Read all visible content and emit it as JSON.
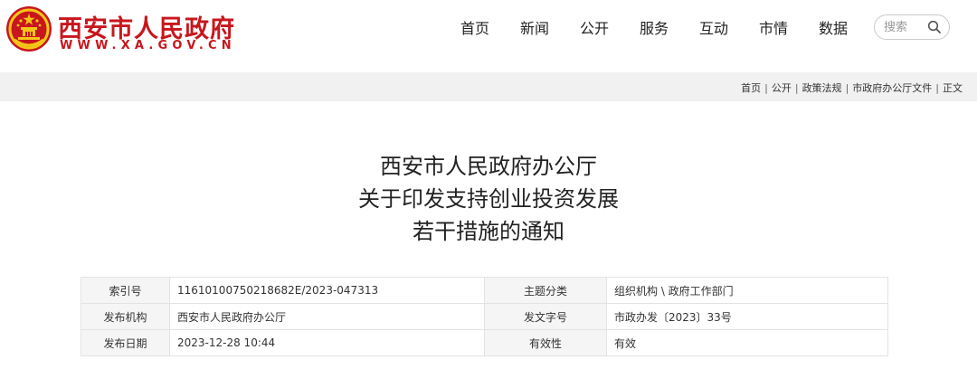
{
  "header": {
    "site_name": "西安市人民政府",
    "site_domain": "WWW.XA.GOV.CN",
    "nav": [
      "首页",
      "新闻",
      "公开",
      "服务",
      "互动",
      "市情",
      "数据"
    ],
    "search_placeholder": "搜索"
  },
  "breadcrumb": [
    "首页",
    "公开",
    "政策法规",
    "市政府办公厅文件",
    "正文"
  ],
  "breadcrumb_sep": "|",
  "title_lines": [
    "西安市人民政府办公厅",
    "关于印发支持创业投资发展",
    "若干措施的通知"
  ],
  "info": {
    "index_label": "索引号",
    "index_value": "11610100750218682E/2023-047313",
    "topic_label": "主题分类",
    "topic_value": "组织机构 \\ 政府工作部门",
    "issuer_label": "发布机构",
    "issuer_value": "西安市人民政府办公厅",
    "docno_label": "发文字号",
    "docno_value": "市政办发〔2023〕33号",
    "date_label": "发布日期",
    "date_value": "2023-12-28 10:44",
    "validity_label": "有效性",
    "validity_value": "有效"
  },
  "colors": {
    "brand_red": "#c8161d",
    "emblem_gold": "#f5c518",
    "band_gray": "#f1f1f1"
  },
  "icons": {
    "emblem": "national-emblem-icon",
    "search": "search-icon"
  }
}
